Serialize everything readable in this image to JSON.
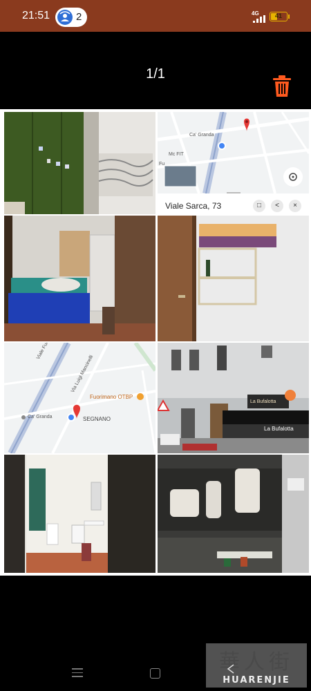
{
  "status_bar": {
    "time": "21:51",
    "hotspot_count": "2",
    "network": "4G",
    "battery_level": "41",
    "battery_percent": 41,
    "background": "#8a3a1e",
    "battery_color": "#e8b400"
  },
  "viewer": {
    "page_counter": "1/1",
    "delete_icon": "trash-icon",
    "delete_color": "#ff5a1f"
  },
  "collage": {
    "map_top": {
      "street_labels": [
        "Ca' Granda",
        "Mc FIT",
        "Fu"
      ],
      "place_name": "Viale Sarca, 73",
      "buttons": [
        "bookmark-icon",
        "share-icon",
        "close-icon"
      ],
      "locate_icon": "locate-icon"
    },
    "map_middle": {
      "labels": [
        "Viale Fulvio Testi",
        "Via Luigi Mancinelli",
        "Fuorimano OTBP",
        "Ca' Granda",
        "SEGNANO"
      ]
    },
    "street_signs": [
      "La Bufalotta",
      "La Bufalotta"
    ]
  },
  "nav_bar": {
    "menu_icon": "menu-icon",
    "home_icon": "home-icon",
    "back_icon": "back-icon"
  },
  "watermark": {
    "chinese": "華人街",
    "english": "HUARENJIE"
  }
}
